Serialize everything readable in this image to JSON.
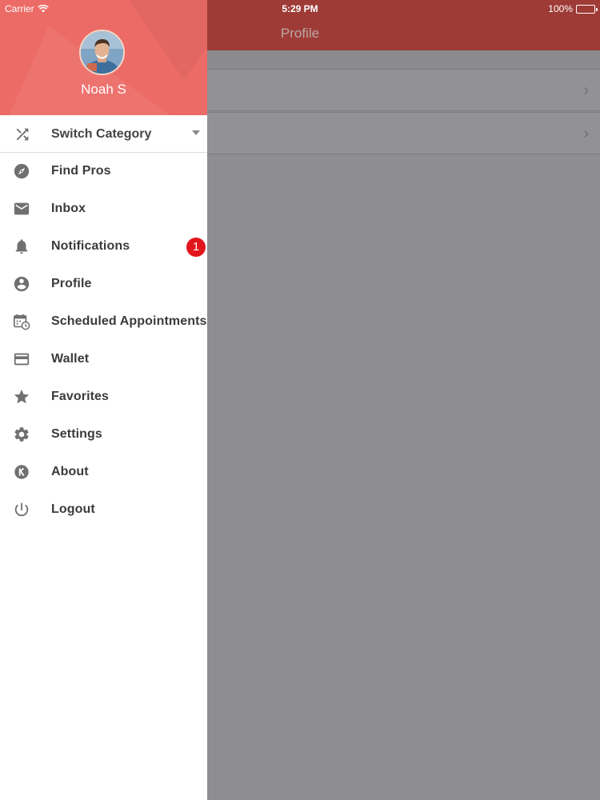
{
  "status_bar": {
    "carrier": "Carrier",
    "time": "5:29 PM",
    "battery": "100%"
  },
  "background_app": {
    "title": "Profile",
    "header_color": "#9e3b36"
  },
  "drawer": {
    "header_color": "#ec6b66",
    "user_name": "Noah S",
    "category": {
      "label": "Switch Category",
      "icon": "shuffle-icon"
    },
    "items": [
      {
        "label": "Find Pros",
        "icon": "compass-icon"
      },
      {
        "label": "Inbox",
        "icon": "envelope-icon"
      },
      {
        "label": "Notifications",
        "icon": "bell-icon",
        "badge": "1"
      },
      {
        "label": "Profile",
        "icon": "account-circle-icon"
      },
      {
        "label": "Scheduled Appointments",
        "icon": "calendar-clock-icon"
      },
      {
        "label": "Wallet",
        "icon": "credit-card-icon"
      },
      {
        "label": "Favorites",
        "icon": "star-icon"
      },
      {
        "label": "Settings",
        "icon": "gear-icon"
      },
      {
        "label": "About",
        "icon": "about-logo-icon"
      },
      {
        "label": "Logout",
        "icon": "power-icon"
      }
    ],
    "badge_color": "#e3151c"
  }
}
